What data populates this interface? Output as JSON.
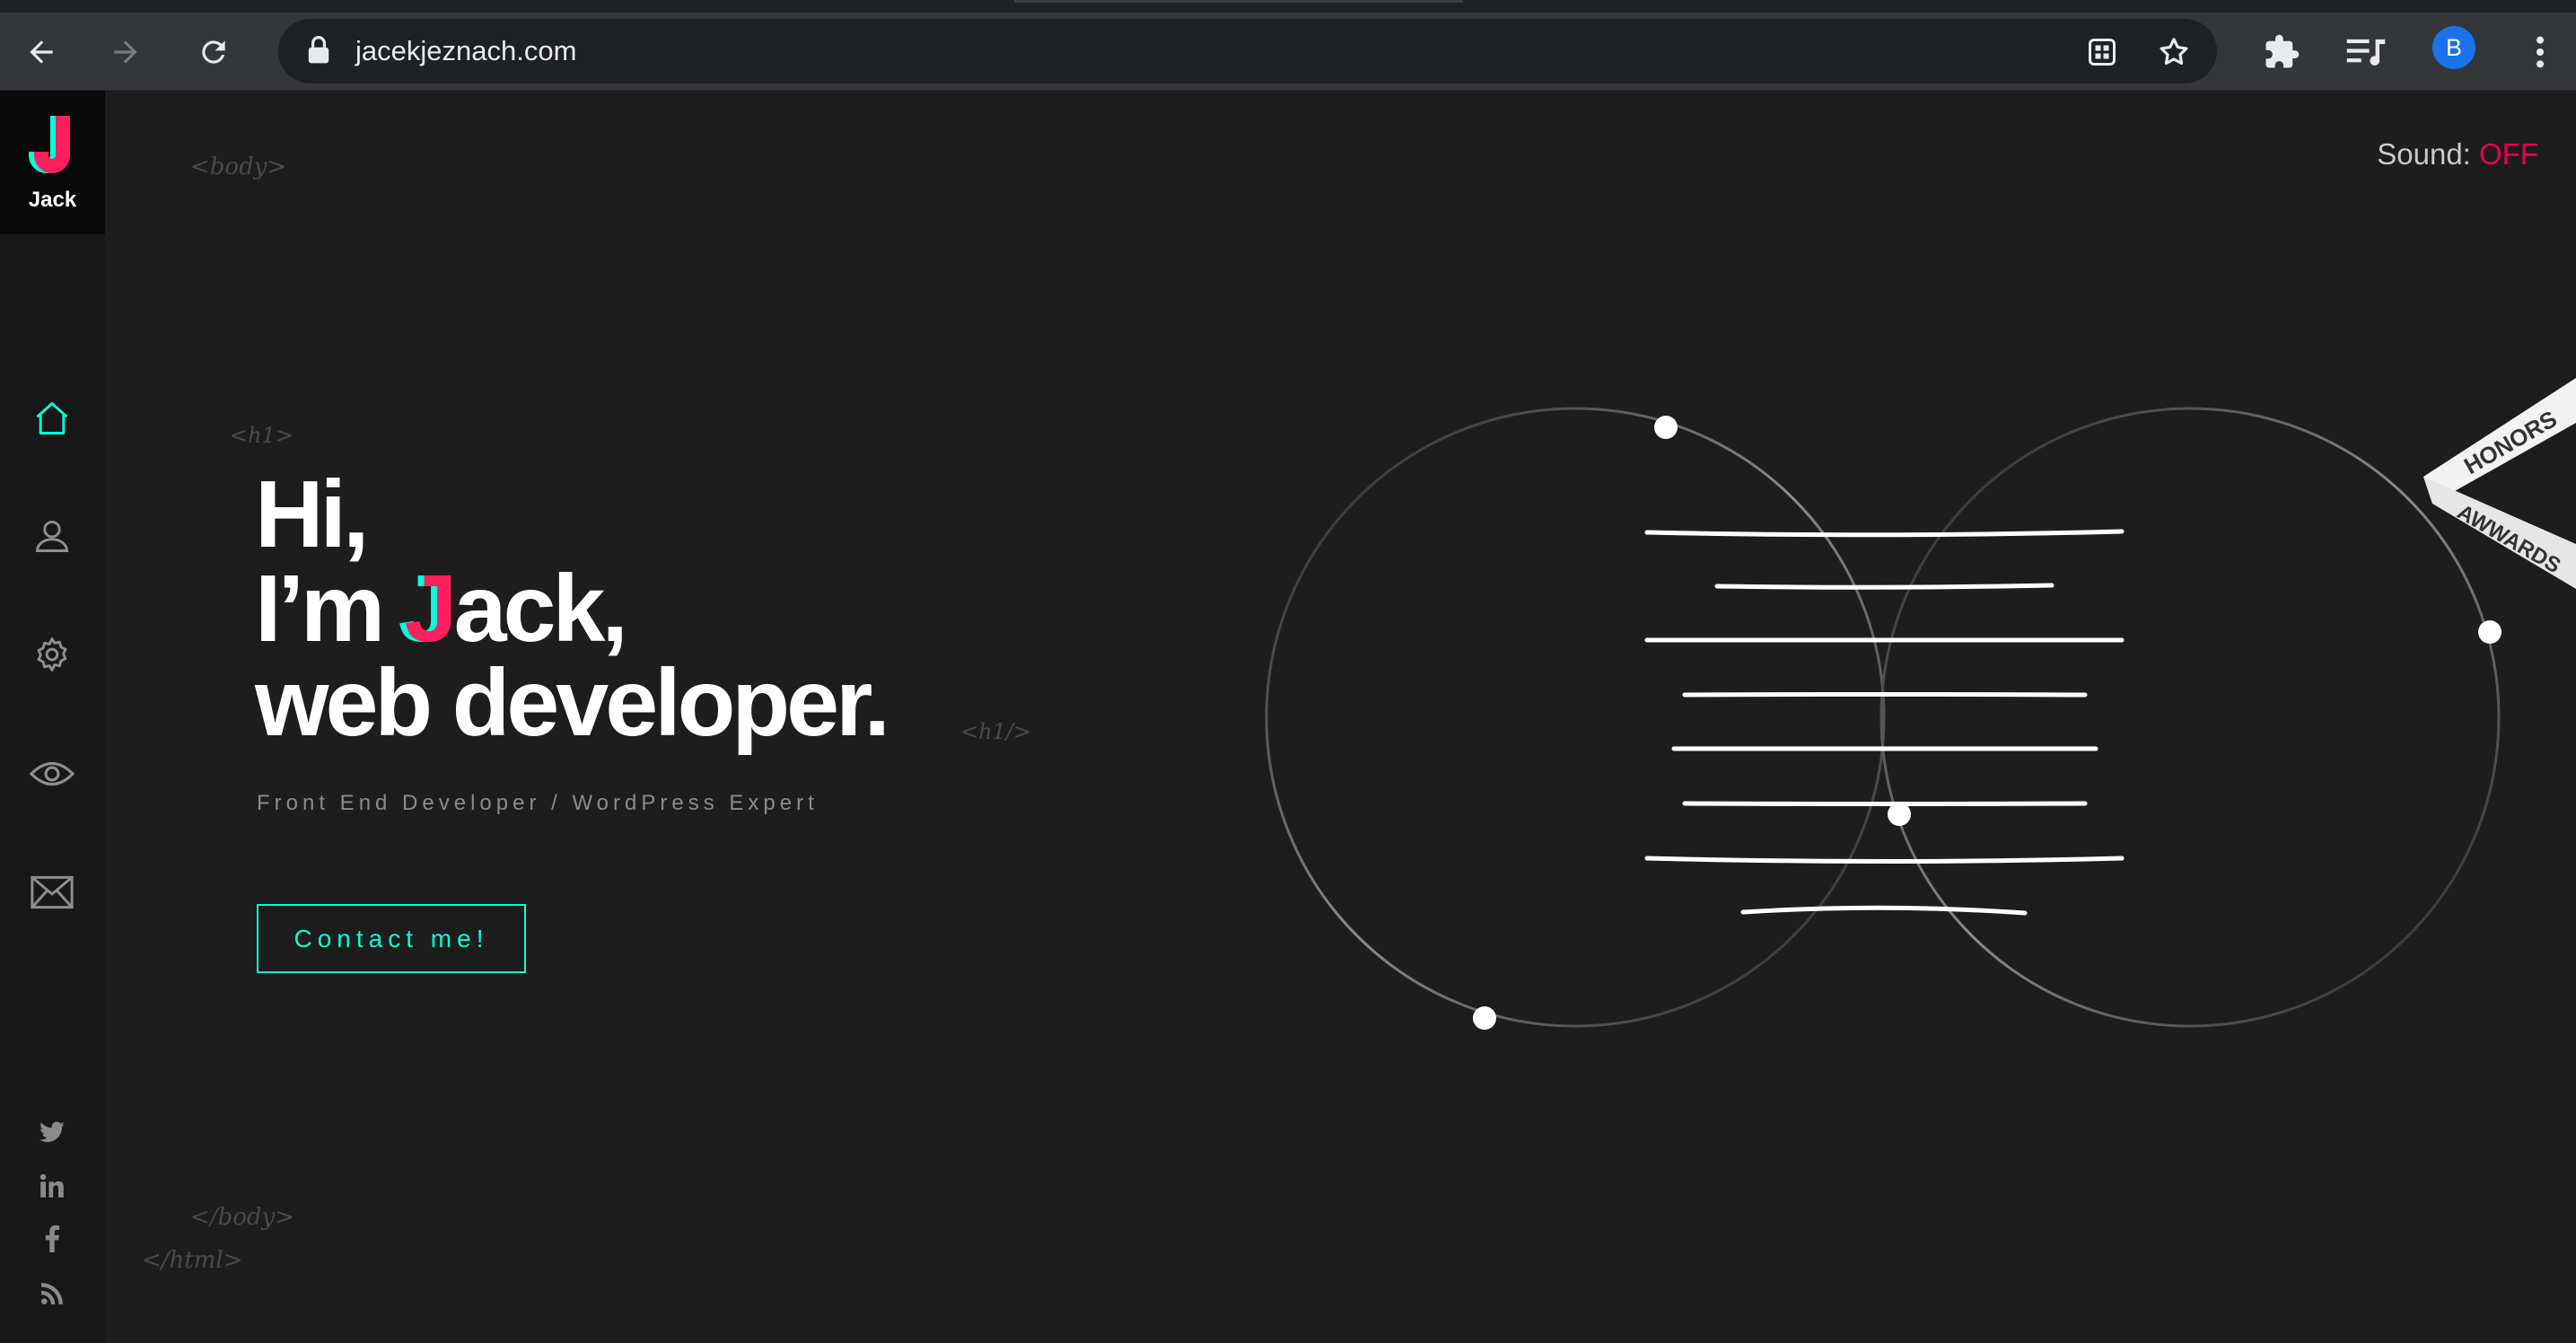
{
  "browser": {
    "url": "jacekjeznach.com",
    "profile_initial": "B"
  },
  "logo": {
    "letter": "J",
    "name": "Jack"
  },
  "sound": {
    "label": "Sound:",
    "state": "OFF"
  },
  "tags": {
    "body_open": "<body>",
    "h1_open": "<h1>",
    "h1_close": "<h1/>",
    "body_close": "</body>",
    "html_close": "</html>"
  },
  "hero": {
    "line1": "Hi,",
    "line2_prefix": "I’m ",
    "line2_letter": "J",
    "line2_suffix": "ack,",
    "line3": "web developer."
  },
  "subtitle": "Front End Developer / WordPress Expert",
  "contact_button": "Contact me!",
  "ribbon": {
    "top": "HONORS",
    "bottom": "AWWARDS"
  },
  "colors": {
    "accent_cyan": "#08fdd8",
    "accent_pink": "#ff1f5e",
    "background": "#1d1d1d",
    "sidebar": "#181818"
  },
  "sidebar_nav": [
    "home-icon",
    "user-icon",
    "gear-icon",
    "eye-icon",
    "envelope-icon"
  ],
  "social": [
    "twitter-icon",
    "linkedin-icon",
    "facebook-icon",
    "rss-icon"
  ]
}
